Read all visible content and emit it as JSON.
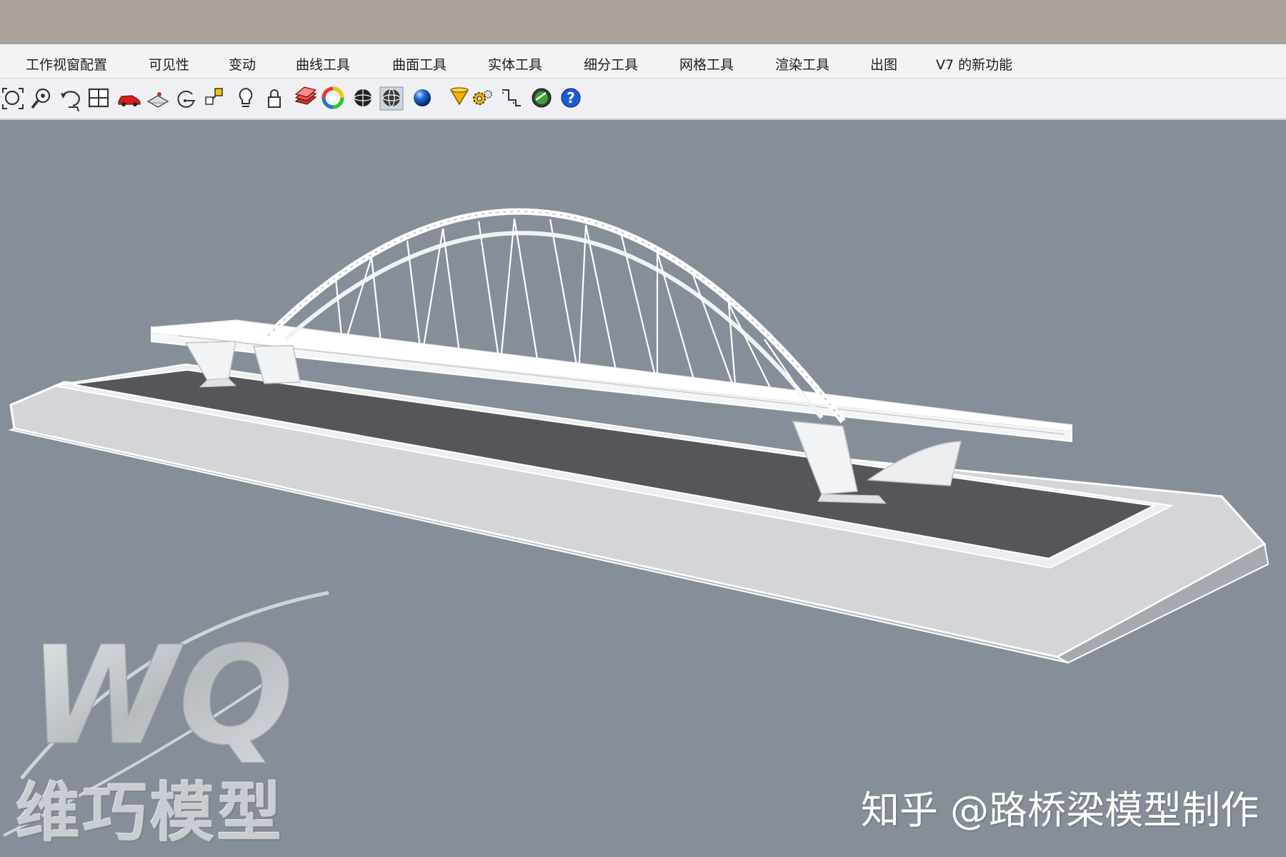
{
  "menu": {
    "items": [
      {
        "label": "工作视窗配置"
      },
      {
        "label": "可见性"
      },
      {
        "label": "变动"
      },
      {
        "label": "曲线工具"
      },
      {
        "label": "曲面工具"
      },
      {
        "label": "实体工具"
      },
      {
        "label": "细分工具"
      },
      {
        "label": "网格工具"
      },
      {
        "label": "渲染工具"
      },
      {
        "label": "出图"
      },
      {
        "label": "V7 的新功能"
      }
    ]
  },
  "toolbar": {
    "icons": [
      "zoom-extents-icon",
      "zoom-window-icon",
      "rotate-view-icon",
      "four-viewports-icon",
      "car-icon",
      "named-view-icon",
      "target-icon",
      "snap-icon",
      "light-icon",
      "lock-icon",
      "layer-icon",
      "color-wheel-icon",
      "shaded-sphere-icon",
      "wireframe-sphere-icon",
      "blue-sphere-icon",
      "cone-icon",
      "gear-icon",
      "dimension-icon",
      "globe-icon",
      "help-icon"
    ]
  },
  "viewport": {
    "background": "#858e99",
    "logo_text": "维巧模型",
    "logo_mark": "WQ",
    "watermark": "知乎 @路桥梁模型制作"
  }
}
